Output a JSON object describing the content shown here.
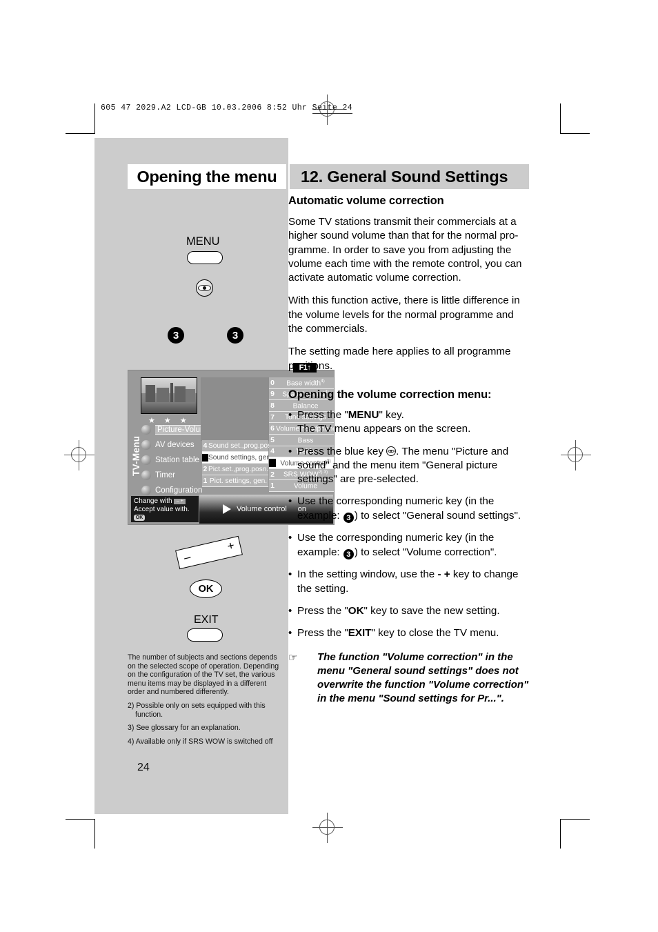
{
  "slug": {
    "prefix": "605 47 2029.A2 LCD-GB  10.03.2006  8:52 Uhr",
    "suffix": "Seite 24"
  },
  "header": {
    "left_title": "Opening the menu",
    "right_title": "12. General Sound Settings"
  },
  "remote": {
    "menu_label": "MENU",
    "blue_key_icon": "eye-icon",
    "numkey_left": "3",
    "numkey_right": "3",
    "plus": "+",
    "minus": "–",
    "ok_label": "OK",
    "exit_label": "EXIT"
  },
  "tv_screen": {
    "f1_tag": "F1↑",
    "menu_word": "TV-Menu",
    "stars": "★ ★ ★",
    "nav_items": [
      {
        "label": "Picture-Volume",
        "selected": true
      },
      {
        "label": "AV devices",
        "selected": false
      },
      {
        "label": "Station table",
        "selected": false
      },
      {
        "label": "Timer",
        "selected": false
      },
      {
        "label": "Configuration",
        "selected": false
      }
    ],
    "middle_column": [
      {
        "num": "4",
        "label": "Sound set.,prog.pos",
        "selected": false
      },
      {
        "num": "3",
        "label": "Sound settings, gen",
        "selected": true
      },
      {
        "num": "2",
        "label": "Pict.set.,prog.posn.",
        "selected": false
      },
      {
        "num": "1",
        "label": "Pict. settings, gen.",
        "selected": false
      }
    ],
    "right_column": [
      {
        "num": "0",
        "label": "Base width",
        "sup": "4)",
        "selected": false
      },
      {
        "num": "9",
        "label": "Spatial sound",
        "sup": "4)",
        "selected": false
      },
      {
        "num": "8",
        "label": "Balance",
        "sup": "",
        "selected": false
      },
      {
        "num": "7",
        "label": "Tone settings",
        "sup": "",
        "selected": false
      },
      {
        "num": "6",
        "label": "Volume headphones",
        "sup": "",
        "selected": false
      },
      {
        "num": "5",
        "label": "Bass",
        "sup": "",
        "selected": false
      },
      {
        "num": "4",
        "label": "Treble",
        "sup": "",
        "selected": false
      },
      {
        "num": "3",
        "label": "Volume control",
        "sup": "3)",
        "selected": true
      },
      {
        "num": "2",
        "label": "SRS WOW",
        "sup": "2) 3)",
        "selected": false
      },
      {
        "num": "1",
        "label": "Volume",
        "sup": "",
        "selected": false
      }
    ],
    "hint_line1": "Change with",
    "hint_line2": "Accept value with.",
    "hint_pm": "– +",
    "hint_ok": "OK",
    "status_title": "Volume control",
    "status_value": "on"
  },
  "content": {
    "h_automatic": "Automatic volume correction",
    "p1": "Some TV stations transmit their commercials at a higher sound volume than that for the normal pro-gramme. In order to save you from adjusting the volume each time with the remote control, you can activate automatic volume correction.",
    "p2": "With this function active, there is little difference in the volume levels for the normal programme and the commercials.",
    "p3": "The setting made here applies to all programme positions.",
    "h_opening": "Opening the volume correction menu:",
    "bullet1_a": "Press the \"",
    "bullet1_key": "MENU",
    "bullet1_b": "\" key.",
    "bullet1_c": "The TV menu appears on the screen.",
    "bullet2_a": "Press the blue key ",
    "bullet2_b": ". The menu \"Picture and sound\" and the menu item \"General picture settings\" are pre-selected.",
    "bullet3_a": "Use the corresponding numeric key (in the example: ",
    "bullet3_num": "3",
    "bullet3_b": ") to select \"General sound settings\".",
    "bullet4_a": "Use the corresponding numeric key (in the example: ",
    "bullet4_num": "3",
    "bullet4_b": ") to select \"Volume correction\".",
    "bullet5_a": "In the setting window, use the ",
    "bullet5_key": "- +",
    "bullet5_b": " key to change the setting.",
    "bullet6_a": "Press the \"",
    "bullet6_key": "OK",
    "bullet6_b": "\" key to save the new setting.",
    "bullet7_a": "Press the \"",
    "bullet7_key": "EXIT",
    "bullet7_b": "\" key to close the TV menu.",
    "note_hand": "☞",
    "note_text": "The function \"Volume correction\" in the menu \"General sound settings\" does not overwrite the function \"Volume correction\" in the menu \"Sound settings for Pr...\"."
  },
  "footnotes": {
    "f1": "The number of subjects and sections depends on the selected scope of operation. Depending on the configuration of the TV set, the various menu items may be displayed in a different order and numbered differently.",
    "f2": "2) Possible only on sets equipped with this function.",
    "f3": "3) See glossary for an explanation.",
    "f4": "4) Available only if SRS WOW is switched off"
  },
  "page_number": "24"
}
